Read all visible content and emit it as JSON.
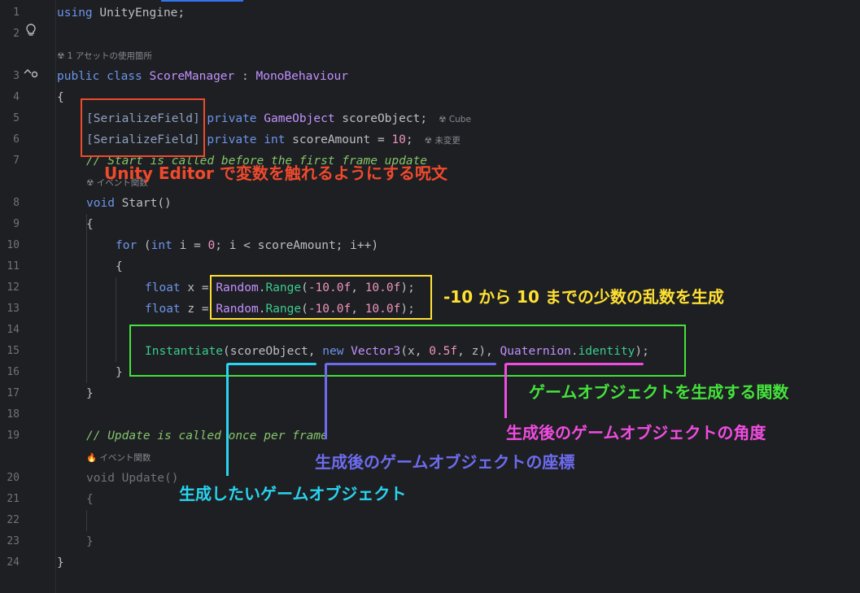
{
  "line_numbers": [
    "1",
    "2",
    "3",
    "4",
    "5",
    "6",
    "7",
    "8",
    "9",
    "10",
    "11",
    "12",
    "13",
    "14",
    "15",
    "16",
    "17",
    "18",
    "19",
    "20",
    "21",
    "22",
    "23",
    "24"
  ],
  "gutter_icons": {
    "bulb": "bulb-icon",
    "override": "implementation-icon"
  },
  "hints": {
    "class_usage": "☢ 1 アセットの使用箇所",
    "start_event": "☢ イベント関数",
    "update_event": "🔥 イベント関数",
    "inlay_cube": "☢ Cube",
    "inlay_unchanged": "☢ 未変更"
  },
  "code": {
    "l1": {
      "kw": "using",
      "rest": " UnityEngine;"
    },
    "l3": {
      "kw1": "public",
      "kw2": " class",
      "name": " ScoreManager",
      "sep": " : ",
      "base": "MonoBehaviour"
    },
    "l4": "{",
    "l5": {
      "attr": "[SerializeField]",
      "kw": " private",
      "type": " GameObject",
      "rest": " scoreObject;"
    },
    "l6": {
      "attr": "[SerializeField]",
      "kw": " private",
      "type": " int",
      "rest": " scoreAmount = ",
      "num": "10",
      "end": ";"
    },
    "l7": "// Start is called before the first frame update",
    "l8": {
      "kw": "void",
      "name": " Start",
      "end": "()"
    },
    "l9": "{",
    "l10": {
      "kw": "for",
      "p1": " (",
      "kw2": "int",
      "rest": " i = ",
      "num": "0",
      "rest2": "; i < scoreAmount; i++)"
    },
    "l11": "{",
    "l12": {
      "kw": "float",
      "v": " x = ",
      "cls": "Random",
      "dot": ".",
      "fn": "Range",
      "a": "(",
      "n1": "-10.0f",
      "c": ", ",
      "n2": "10.0f",
      "e": ");"
    },
    "l13": {
      "kw": "float",
      "v": " z = ",
      "cls": "Random",
      "dot": ".",
      "fn": "Range",
      "a": "(",
      "n1": "-10.0f",
      "c": ", ",
      "n2": "10.0f",
      "e": ");"
    },
    "l15": {
      "fn": "Instantiate",
      "a": "(scoreObject, ",
      "kw": "new",
      "ty": " Vector3",
      "b": "(x, ",
      "num": "0.5f",
      "c": ", z), ",
      "q": "Quaternion",
      "dot": ".",
      "id": "identity",
      "e": ");"
    },
    "l16": "}",
    "l17": "}",
    "l19": "// Update is called once per frame",
    "l20": {
      "kw": "void",
      "name": " Update",
      "end": "()"
    },
    "l21": "{",
    "l23": "}",
    "l24": "}"
  },
  "annotations": {
    "serialize": "Unity Editor で変数を触れるようにする呪文",
    "random": "-10 から 10 までの少数の乱数を生成",
    "instantiate": "ゲームオブジェクトを生成する関数",
    "rotation": "生成後のゲームオブジェクトの角度",
    "position": "生成後のゲームオブジェクトの座標",
    "object": "生成したいゲームオブジェクト"
  },
  "colors": {
    "serialize": "#f04a2d",
    "random": "#ffe033",
    "instantiate": "#44e23c",
    "rotation": "#f04ce0",
    "position": "#6d6cf0",
    "object": "#28d4f0"
  }
}
